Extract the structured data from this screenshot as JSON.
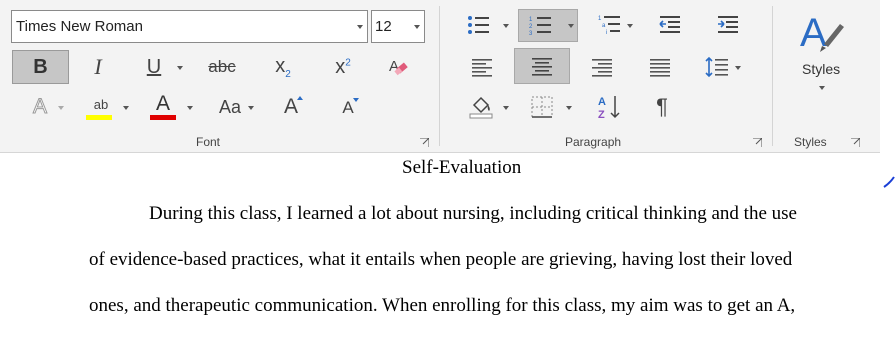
{
  "font_group": {
    "font_name": "Times New Roman",
    "font_size": "12",
    "label": "Font",
    "bold_glyph": "B",
    "italic_glyph": "I",
    "underline_glyph": "U",
    "strike_glyph": "abc",
    "subscript_glyph": "x",
    "subscript_sub": "2",
    "superscript_glyph": "x",
    "superscript_sup": "2",
    "text_effects_glyph": "A",
    "highlight_glyph": "ab",
    "font_color_glyph": "A",
    "change_case_glyph": "Aa",
    "grow_glyph": "A",
    "shrink_glyph": "A",
    "highlight_color": "#ffff00",
    "font_color": "#e00000"
  },
  "paragraph_group": {
    "label": "Paragraph",
    "numbering_glyph": "1 2 3",
    "sort_glyph_top": "A",
    "sort_glyph_bottom": "Z",
    "pilcrow_glyph": "¶"
  },
  "styles_group": {
    "label": "Styles",
    "button_label": "Styles",
    "icon_glyph": "A"
  },
  "document": {
    "title": "Self-Evaluation",
    "line1": "During this class, I learned a lot about nursing, including critical thinking and the use",
    "line2": "of evidence-based practices, what it entails when people are grieving, having lost their loved",
    "line3": "ones, and therapeutic communication. When enrolling for this class, my aim was to get an A,"
  }
}
